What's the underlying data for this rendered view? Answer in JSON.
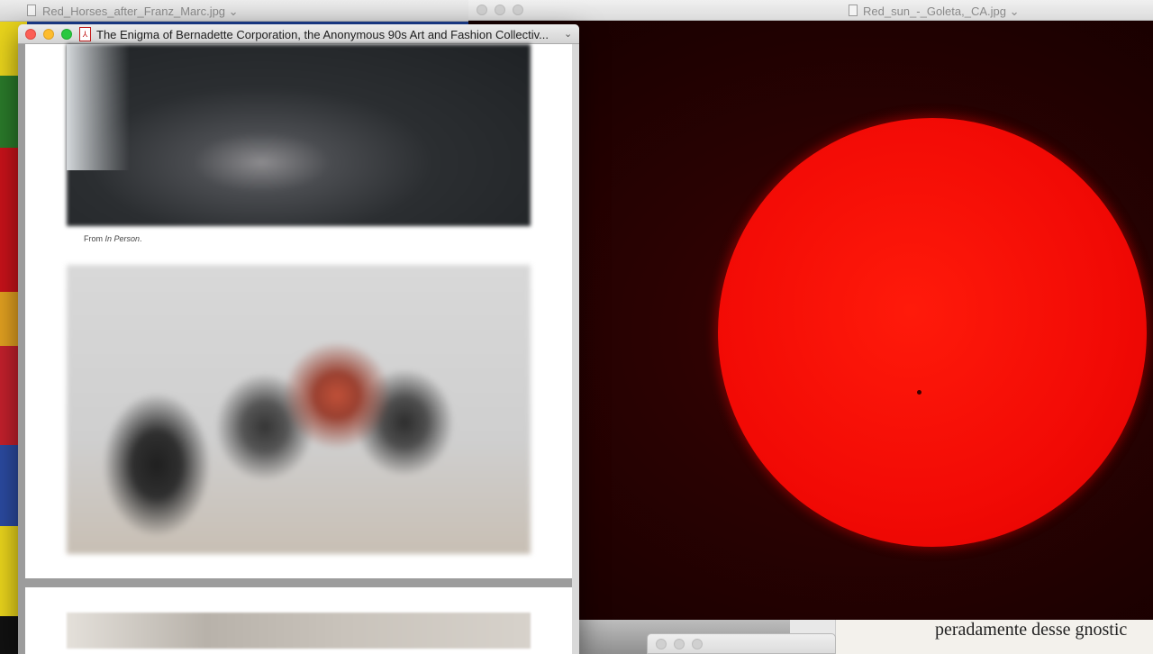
{
  "windows": {
    "horses": {
      "title": "Red_Horses_after_Franz_Marc.jpg",
      "chevron": "⌄"
    },
    "sun": {
      "title": "Red_sun_-_Goleta,_CA.jpg",
      "chevron": "⌄"
    },
    "pdf": {
      "title": "The Enigma of Bernadette Corporation, the Anonymous 90s Art and Fashion Collectiv...",
      "chevron": "⌄",
      "caption_prefix": "From ",
      "caption_italic": "In Person",
      "caption_suffix": "."
    },
    "background_doc": {
      "text": "peradamente desse gnostic"
    }
  },
  "colors": {
    "close": "#fc5f57",
    "minimize": "#fdbc2e",
    "maximize": "#28c840",
    "sun": "#f20a05"
  }
}
